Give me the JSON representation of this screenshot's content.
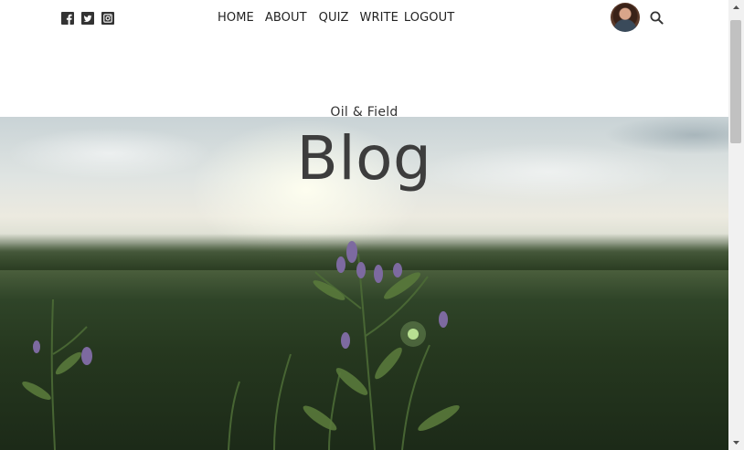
{
  "social": {
    "icons": [
      "facebook-icon",
      "twitter-icon",
      "instagram-icon"
    ]
  },
  "nav": {
    "home": "HOME",
    "about": "ABOUT",
    "quiz": "QUIZ",
    "write": "WRITE",
    "logout": "LOGOUT"
  },
  "header": {
    "avatar_icon": "user-avatar",
    "search_icon": "search-icon"
  },
  "hero": {
    "eyebrow": "Oil & Field",
    "title": "Blog"
  },
  "colors": {
    "text": "#222222",
    "title": "#3d3d3d",
    "background": "#ffffff"
  }
}
